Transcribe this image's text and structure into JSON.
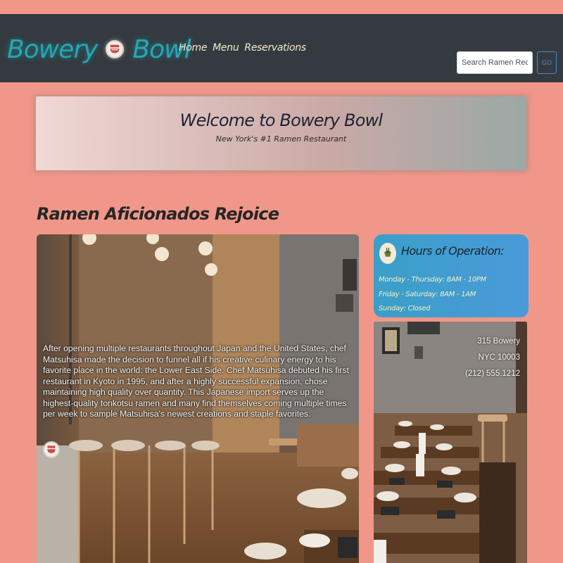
{
  "brand": {
    "name_part1": "Bowery",
    "name_part2": "Bowl",
    "logo_icon": "ramen-bowl-icon",
    "color": "#23a7b4"
  },
  "nav": {
    "items": [
      {
        "label": "Home"
      },
      {
        "label": "Menu"
      },
      {
        "label": "Reservations"
      }
    ]
  },
  "search": {
    "placeholder": "Search Ramen Recipes",
    "button_label": "GO"
  },
  "jumbotron": {
    "title": "Welcome to Bowery Bowl",
    "subtitle": "New York's #1 Ramen Restaurant"
  },
  "section": {
    "heading": "Ramen Aficionados Rejoice"
  },
  "hero": {
    "caption": "After opening multiple restaurants throughout Japan and the United States, chef Matsuhisa made the decision to funnel all if his creative culinary energy to his favorite place in the world: the Lower East Side. Chef Matsuhisa debuted his first restaurant in Kyoto in 1995, and after a highly successful expansion, chose maintaining high quality over quantity. This Japanese import serves up the highest-quality tonkotsu ramen and many find themselves coming multiple times per week to sample Matsuhisa's newest creations and staple favorites."
  },
  "hours": {
    "title": "Hours of Operation:",
    "lines": [
      "Monday - Thursday: 8AM - 10PM",
      "Friday - Saturday: 8AM - 1AM",
      "Sunday: Closed"
    ]
  },
  "address": {
    "street": "315 Bowery",
    "city": "NYC 10003",
    "phone": "(212) 555.1212"
  },
  "colors": {
    "page_bg": "#f0978a",
    "navbar_bg": "#343a40",
    "nav_text": "#f3ead0",
    "hours_bg": "#4a9ad9"
  }
}
